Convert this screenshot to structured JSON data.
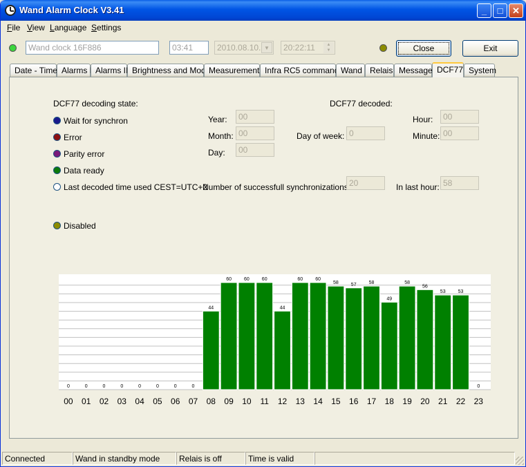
{
  "window": {
    "title": "Wand Alarm Clock V3.41"
  },
  "menu": [
    {
      "first": "F",
      "rest": "ile"
    },
    {
      "first": "V",
      "rest": "iew"
    },
    {
      "first": "L",
      "rest": "anguage"
    },
    {
      "first": "S",
      "rest": "ettings"
    }
  ],
  "toolbar": {
    "device_name": "Wand clock 16F886",
    "time_short": "03:41",
    "date": "2010.08.10.",
    "time_full": "20:22:11",
    "close_label": "Close",
    "exit_label": "Exit"
  },
  "tabs": [
    "Date - Time",
    "Alarms I",
    "Alarms II",
    "Brightness and Mode",
    "Measurements",
    "Infra RC5 commands",
    "Wand",
    "Relais",
    "Message",
    "DCF77",
    "System"
  ],
  "active_tab": "DCF77",
  "dcf": {
    "state_title": "DCF77 decoding state:",
    "decoded_title": "DCF77 decoded:",
    "states": [
      {
        "label": "Wait for synchron",
        "color": "#1a1a8c"
      },
      {
        "label": "Error",
        "color": "#8c1010"
      },
      {
        "label": "Parity error",
        "color": "#7a1a7a"
      },
      {
        "label": "Data ready",
        "color": "#0c7a0c"
      },
      {
        "label": "Last decoded time used CEST=UTC+2",
        "color": "#ffffff"
      }
    ],
    "disabled_label": "Disabled",
    "year_label": "Year:",
    "year": "00",
    "month_label": "Month:",
    "month": "00",
    "day_label": "Day:",
    "day": "00",
    "dow_label": "Day of week:",
    "dow": "0",
    "hour_label": "Hour:",
    "hour": "00",
    "minute_label": "Minute:",
    "minute": "00",
    "sync_label": "Number of successfull synchronizationsr:",
    "sync": "20",
    "lasthour_label": "In last hour:",
    "lasthour": "58"
  },
  "chart_data": {
    "type": "bar",
    "categories": [
      "00",
      "01",
      "02",
      "03",
      "04",
      "05",
      "06",
      "07",
      "08",
      "09",
      "10",
      "11",
      "12",
      "13",
      "14",
      "15",
      "16",
      "17",
      "18",
      "19",
      "20",
      "21",
      "22",
      "23"
    ],
    "values": [
      0,
      0,
      0,
      0,
      0,
      0,
      0,
      0,
      44,
      60,
      60,
      60,
      44,
      60,
      60,
      58,
      57,
      58,
      49,
      58,
      56,
      53,
      53,
      0
    ],
    "ylim": [
      0,
      60
    ],
    "grid": true,
    "bar_color": "#008000"
  },
  "status": [
    "Connected",
    "Wand in standby mode",
    "Relais is off",
    "Time is valid",
    ""
  ]
}
